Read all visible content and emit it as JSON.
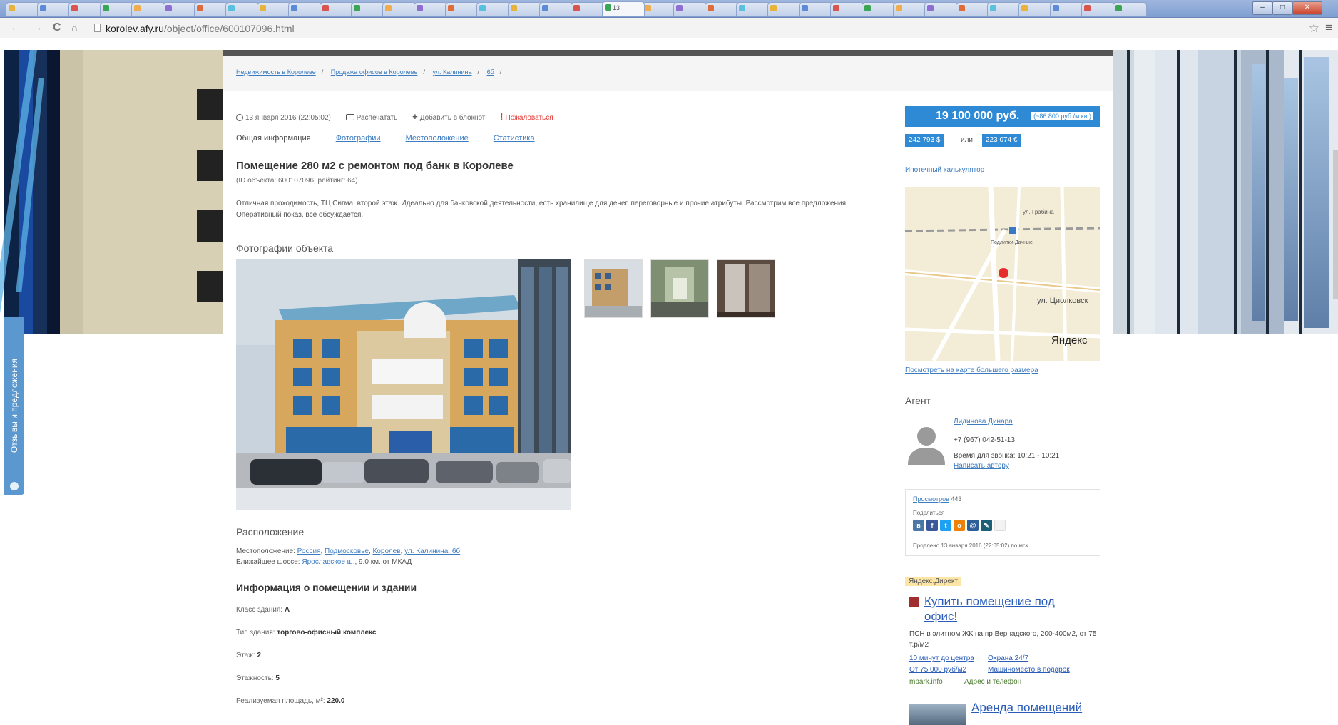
{
  "browser": {
    "active_tab_label": "13",
    "url_host": "korolev.afy.ru",
    "url_path": "/object/office/600107096.html"
  },
  "side_tab": {
    "label": "Отзывы и предложения"
  },
  "breadcrumbs": [
    "Недвижимость в Королеве",
    "Продажа офисов в Королеве",
    "ул. Калинина",
    "6б"
  ],
  "meta": {
    "date": "13 января 2016 (22:05:02)",
    "print_label": "Распечатать",
    "notebook_label": "Добавить в блокнот",
    "complain_label": "Пожаловаться"
  },
  "tabs": [
    "Общая информация",
    "Фотографии",
    "Местоположение",
    "Статистика"
  ],
  "listing": {
    "title": "Помещение 280 м2 с ремонтом под банк в Королеве",
    "id_line": "(ID объекта: 600107096, рейтинг: 64)",
    "description": "Отличная проходимость, ТЦ Сигма, второй этаж. Идеально для банковской деятельности, есть хранилище для денег, переговорные и прочие атрибуты. Рассмотрим все предложения. Оперативный показ, все обсуждается."
  },
  "photos_heading": "Фотографии объекта",
  "location": {
    "heading": "Расположение",
    "label": "Местоположение:",
    "links": [
      "Россия",
      "Подмосковье",
      "Королев",
      "ул. Калинина, 6б"
    ],
    "highway_label": "Ближайшее шоссе:",
    "highway_link": "Ярославское ш.",
    "highway_distance": ", 9.0 км. от МКАД"
  },
  "info": {
    "heading": "Информация о помещении и здании",
    "rows": [
      {
        "label": "Класс здания:",
        "value": "A"
      },
      {
        "label": "Тип здания:",
        "value": "торгово-офисный комплекс"
      },
      {
        "label": "Этаж:",
        "value": "2"
      },
      {
        "label": "Этажность:",
        "value": "5"
      },
      {
        "label": "Реализуемая площадь, м²:",
        "value": "220.0"
      }
    ]
  },
  "price": {
    "amount": "19 100 000 руб.",
    "per_meter": "(~86 800 руб./м.кв.)",
    "usd": "242 793 $",
    "or": "или",
    "eur": "223 074 €",
    "mortgage_link": "Ипотечный калькулятор"
  },
  "map": {
    "street_label_1": "ул. Грабина",
    "street_label_2": "ул. Циолковск",
    "station_label": "Подлипки-Дачные",
    "logo": "Яндекс",
    "link": "Посмотреть на карте большего размера"
  },
  "agent": {
    "heading": "Агент",
    "name": "Лидинова Динара",
    "phone": "+7 (967) 042-51-13",
    "hours": "Время для звонка: 10:21 - 10:21",
    "write_link": "Написать автору"
  },
  "stats": {
    "views_link": "Просмотров",
    "views_count": "443",
    "share_label": "Поделиться",
    "prolonged": "Продлено 13 января 2016 (22:05:02) по мск"
  },
  "ads": {
    "label": "Яндекс.Директ",
    "ad1_title": "Купить помещение под офис!",
    "ad1_desc": "ПСН в элитном ЖК на пр Вернадского, 200-400м2, от 75 т.р/м2",
    "ad1_link1": "10 минут до центра",
    "ad1_link2": "Охрана 24/7",
    "ad1_link3": "От 75 000 руб/м2",
    "ad1_link4": "Машиноместо в подарок",
    "ad1_domain": "mpark.info",
    "ad1_contacts": "Адрес и телефон",
    "ad2_title": "Аренда помещений"
  },
  "colors": {
    "accent": "#2f8ad6",
    "link": "#3b7cc1",
    "complain": "#e53935"
  }
}
